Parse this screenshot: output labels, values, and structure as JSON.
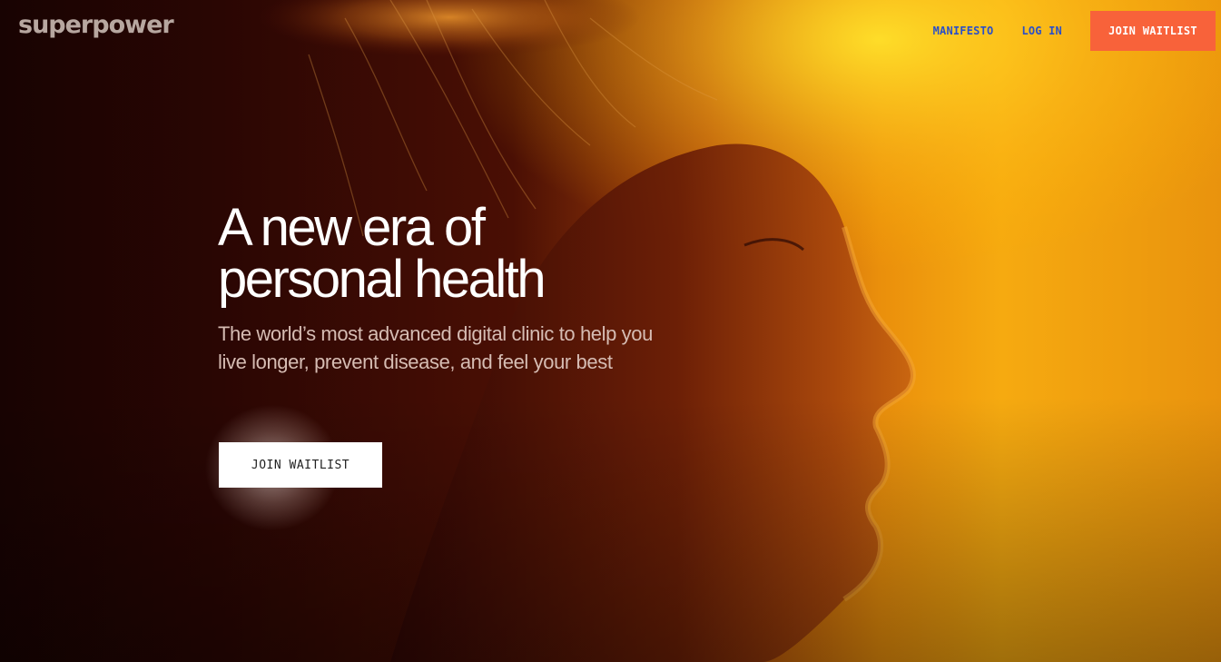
{
  "brand": {
    "logo_text": "superpower"
  },
  "nav": {
    "links": [
      {
        "label": "MANIFESTO"
      },
      {
        "label": "LOG IN"
      }
    ],
    "cta_label": "JOIN WAITLIST"
  },
  "hero": {
    "headline_line1": "A new era of",
    "headline_line2": "personal health",
    "subheadline": "The world’s most advanced digital clinic to help you live longer, prevent disease, and feel your best",
    "cta_label": "JOIN WAITLIST",
    "image": "portrait-backlit-woman-profile"
  },
  "colors": {
    "accent": "#f8623a",
    "nav_link": "#2a4fc8",
    "background_glow": "#f5a20c",
    "background_dark": "#1a0402"
  }
}
